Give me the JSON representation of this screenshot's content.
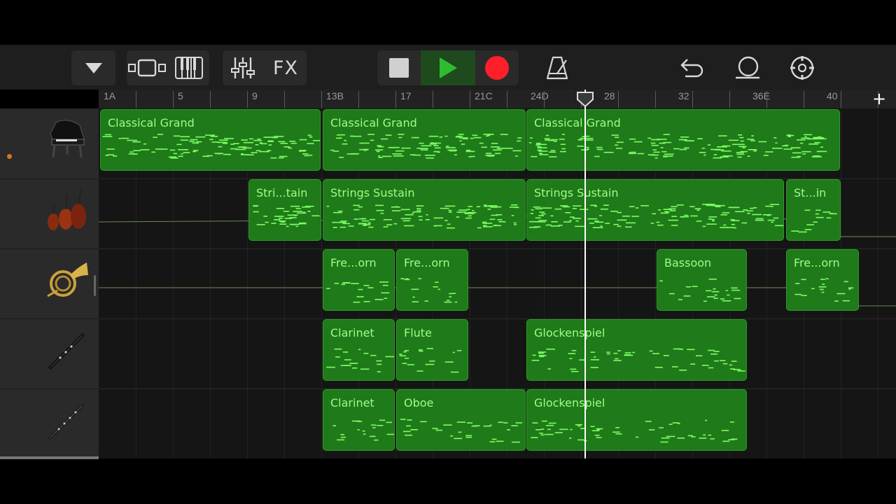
{
  "toolbar": {
    "fx_label": "FX",
    "icons": [
      "tracks-dropdown-icon",
      "loop-browser-icon",
      "keyboard-icon",
      "mixer-icon",
      "fx-button",
      "stop-icon",
      "play-icon",
      "record-icon",
      "metronome-icon",
      "undo-icon",
      "loop-icon",
      "settings-icon"
    ],
    "play_color": "#2fbd2f",
    "record_color": "#ff1f2a"
  },
  "ruler": {
    "labels": [
      "1A",
      "5",
      "9",
      "13B",
      "17",
      "21C",
      "24D",
      "28",
      "32",
      "36E",
      "40"
    ],
    "add_label": "+"
  },
  "tracks": [
    {
      "instrument": "grand-piano",
      "regions": [
        "Classical Grand",
        "Classical Grand",
        "Classical Grand"
      ]
    },
    {
      "instrument": "strings",
      "regions": [
        "Stri...tain",
        "Strings Sustain",
        "Strings Sustain",
        "St...in"
      ]
    },
    {
      "instrument": "french-horn",
      "regions": [
        "Fre...orn",
        "Fre...orn",
        "Bassoon",
        "Fre...orn"
      ]
    },
    {
      "instrument": "clarinet",
      "regions": [
        "Clarinet",
        "Flute",
        "Glockenspiel"
      ]
    },
    {
      "instrument": "oboe",
      "regions": [
        "Clarinet",
        "Oboe",
        "Glockenspiel"
      ]
    }
  ],
  "colors": {
    "region_fill": "#1f7a1a",
    "region_text": "#9dff86",
    "accent": "#2fbd2f"
  }
}
